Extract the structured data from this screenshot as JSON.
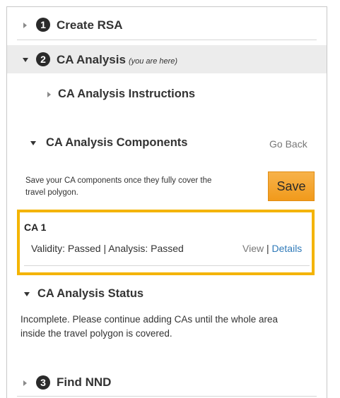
{
  "steps": [
    {
      "number": "1",
      "label": "Create RSA"
    },
    {
      "number": "2",
      "label": "CA Analysis",
      "note": "(you are here)"
    },
    {
      "number": "3",
      "label": "Find NND"
    }
  ],
  "ca_analysis": {
    "instructions_label": "CA Analysis Instructions",
    "components": {
      "label": "CA Analysis Components",
      "go_back": "Go Back",
      "help_text": "Save your CA components once they fully cover the travel polygon.",
      "save_label": "Save",
      "items": [
        {
          "name": "CA 1",
          "status": "Validity: Passed | Analysis: Passed",
          "view_label": "View",
          "separator": "|",
          "details_label": "Details"
        }
      ]
    },
    "status": {
      "label": "CA Analysis Status",
      "text": "Incomplete. Please continue adding CAs until the whole area inside the travel polygon is covered."
    }
  },
  "colors": {
    "highlight": "#f4b400",
    "save_button": "#f19a1b",
    "details_link": "#2f7ab9",
    "header_bar": "#ececec"
  },
  "icons": [
    "chevron-right-icon",
    "chevron-down-icon",
    "step-number-badge"
  ]
}
